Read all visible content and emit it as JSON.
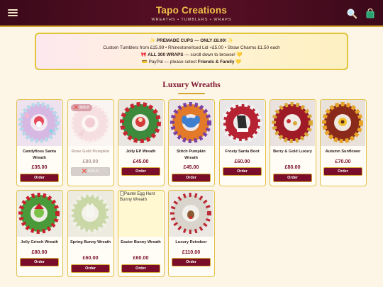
{
  "header": {
    "title": "Tapo Creations",
    "subtitle": "WREATHS • TUMBLERS • WRAPS",
    "menu_icon": "menu-icon",
    "search_icon": "search-icon",
    "bag_icon": "shopping-bag-icon",
    "bg_color": "#4a0c20",
    "accent_color": "#f1c24a"
  },
  "banner": {
    "line1_pre": "✨ ",
    "line1_bold": "PREMADE CUPS — ONLY £8.00!",
    "line1_post": " ✨",
    "line2": "Custom Tumblers from £15.99 • Rhinestone/Iced Lid +£5.00 • Straw Charms £1.50 each",
    "line3_pre": "🎀 ",
    "line3_bold": "ALL 300 WRAPS",
    "line3_post": " — scroll down to browse! 💛",
    "line4_pre": "💳 PayPal — please select ",
    "line4_bold": "Friends & Family",
    "line4_post": " 💛"
  },
  "section": {
    "title": "Luxury Wreaths"
  },
  "products": [
    {
      "name": "Candyfloss Santa Wreath",
      "price": "£35.00",
      "button": "Order",
      "sold": false
    },
    {
      "name": "Rose Gold Pumpkin",
      "price": "£80.00",
      "button": "❌ SOLD",
      "sold": true,
      "badge": "❌ SOLD"
    },
    {
      "name": "Jolly Elf Wreath",
      "price": "£45.00",
      "button": "Order",
      "sold": false
    },
    {
      "name": "Stitch Pumpkin Wreath",
      "price": "£45.00",
      "button": "Order",
      "sold": false
    },
    {
      "name": "Frosty Santa Boot",
      "price": "£60.00",
      "button": "Order",
      "sold": false
    },
    {
      "name": "Berry & Gold Luxury",
      "price": "£80.00",
      "button": "Order",
      "sold": false
    },
    {
      "name": "Autumn Sunflower",
      "price": "£70.00",
      "button": "Order",
      "sold": false
    },
    {
      "name": "Jolly Grinch Wreath",
      "price": "£80.00",
      "button": "Order",
      "sold": false
    },
    {
      "name": "Spring Bunny Wreath",
      "price": "£60.00",
      "button": "Order",
      "sold": false
    },
    {
      "name": "Easter Bunny Wreath",
      "price": "£60.00",
      "button": "Order",
      "sold": false,
      "broken_alt": "Pastel Egg Hunt Bunny Wreath"
    },
    {
      "name": "Luxury Reindeer",
      "price": "£110.00",
      "button": "Order",
      "sold": false
    }
  ]
}
